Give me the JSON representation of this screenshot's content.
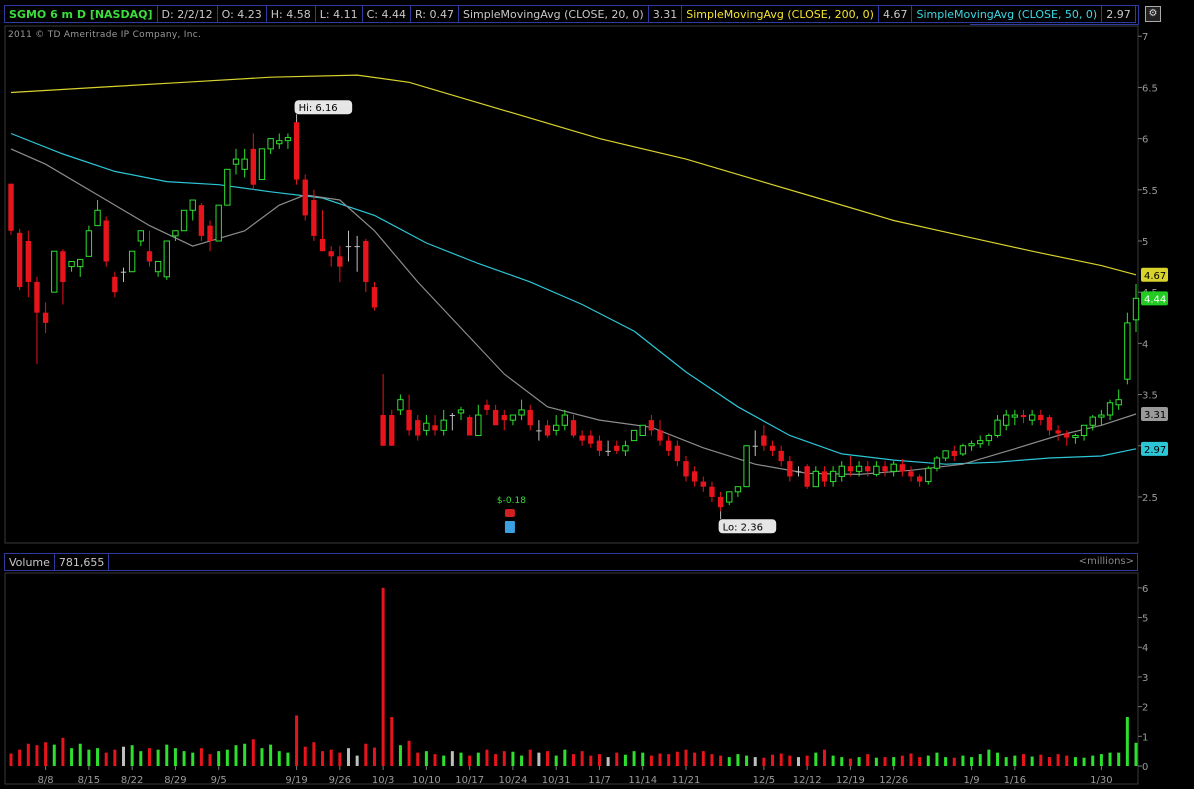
{
  "header": {
    "symbol": "SGMO 6 m D [NASDAQ]",
    "date": "D: 2/2/12",
    "open": "O: 4.23",
    "high": "H: 4.58",
    "low": "L: 4.11",
    "close": "C: 4.44",
    "range": "R: 0.47",
    "sma20_label": "SimpleMovingAvg (CLOSE, 20, 0)",
    "sma20_value": "3.31",
    "sma200_label": "SimpleMovingAvg (CLOSE, 200, 0)",
    "sma200_value": "4.67",
    "sma50_label": "SimpleMovingAvg (CLOSE, 50, 0)",
    "sma50_value": "2.97"
  },
  "copyright": "2011 © TD Ameritrade IP Company, Inc.",
  "volume_panel": {
    "label": "Volume",
    "value": "781,655",
    "units": "<millions>"
  },
  "annotations": {
    "hi": "Hi: 6.16",
    "lo": "Lo: 2.36",
    "event": "$-0.18"
  },
  "chart_data": [
    {
      "type": "candlestick",
      "title": "SGMO 6 m D [NASDAQ]",
      "ylim": [
        2.05,
        7.1
      ],
      "yticks": [
        2.5,
        3,
        3.5,
        4,
        4.5,
        5,
        5.5,
        6,
        6.5,
        7
      ],
      "x_tick_labels": [
        "8/8",
        "8/15",
        "8/22",
        "8/29",
        "9/5",
        "9/19",
        "9/26",
        "10/3",
        "10/10",
        "10/17",
        "10/24",
        "10/31",
        "11/7",
        "11/14",
        "11/21",
        "12/5",
        "12/12",
        "12/19",
        "12/26",
        "1/9",
        "1/16",
        "1/30"
      ],
      "x_tick_days": [
        4,
        9,
        14,
        19,
        24,
        33,
        38,
        43,
        48,
        53,
        58,
        63,
        68,
        73,
        78,
        87,
        92,
        97,
        102,
        111,
        116,
        126
      ],
      "candles": [
        [
          5.56,
          5.45,
          5.1,
          5.06
        ],
        [
          5.08,
          5.12,
          4.55,
          4.52
        ],
        [
          5.0,
          5.1,
          4.6,
          4.45
        ],
        [
          4.6,
          4.65,
          4.3,
          3.8
        ],
        [
          4.3,
          4.4,
          4.2,
          4.1
        ],
        [
          4.5,
          4.5,
          4.9,
          4.85
        ],
        [
          4.9,
          4.92,
          4.6,
          4.38
        ],
        [
          4.75,
          4.8,
          4.8,
          4.7
        ],
        [
          4.75,
          4.75,
          4.82,
          4.65
        ],
        [
          4.85,
          4.95,
          5.1,
          5.15
        ],
        [
          5.15,
          5.3,
          5.3,
          5.4
        ],
        [
          5.2,
          5.24,
          4.8,
          4.75
        ],
        [
          4.65,
          4.7,
          4.5,
          4.45
        ],
        [
          4.7,
          4.74,
          4.7,
          4.6
        ],
        [
          4.7,
          4.7,
          4.9,
          4.85
        ],
        [
          5.0,
          5.08,
          5.1,
          4.95
        ],
        [
          4.9,
          5.1,
          4.8,
          4.75
        ],
        [
          4.7,
          4.72,
          4.8,
          4.65
        ],
        [
          4.65,
          4.65,
          5.0,
          4.62
        ],
        [
          5.05,
          5.05,
          5.1,
          5.0
        ],
        [
          5.1,
          5.3,
          5.3,
          5.1
        ],
        [
          5.3,
          5.4,
          5.4,
          5.2
        ],
        [
          5.35,
          5.37,
          5.05,
          5.0
        ],
        [
          5.15,
          5.2,
          5.0,
          4.9
        ],
        [
          5.0,
          5.05,
          5.35,
          5.0
        ],
        [
          5.35,
          5.4,
          5.7,
          5.35
        ],
        [
          5.75,
          5.9,
          5.8,
          5.65
        ],
        [
          5.7,
          5.9,
          5.8,
          5.62
        ],
        [
          5.9,
          6.05,
          5.55,
          5.5
        ],
        [
          5.6,
          5.8,
          5.9,
          5.6
        ],
        [
          5.9,
          6.0,
          6.0,
          5.85
        ],
        [
          5.95,
          6.05,
          5.98,
          5.9
        ],
        [
          5.98,
          6.05,
          6.01,
          5.9
        ],
        [
          6.16,
          6.16,
          5.6,
          5.55
        ],
        [
          5.6,
          5.65,
          5.25,
          5.2
        ],
        [
          5.4,
          5.5,
          5.05,
          5.0
        ],
        [
          5.02,
          5.3,
          4.9,
          4.9
        ],
        [
          4.9,
          4.95,
          4.85,
          4.75
        ],
        [
          4.85,
          4.95,
          4.75,
          4.6
        ],
        [
          4.95,
          5.1,
          4.95,
          4.8
        ],
        [
          4.95,
          5.05,
          4.95,
          4.7
        ],
        [
          5.0,
          5.02,
          4.6,
          4.5
        ],
        [
          4.55,
          4.6,
          4.35,
          4.32
        ],
        [
          3.3,
          3.7,
          3.0,
          3.0
        ],
        [
          3.3,
          3.35,
          3.0,
          3.0
        ],
        [
          3.35,
          3.5,
          3.45,
          3.3
        ],
        [
          3.35,
          3.5,
          3.15,
          3.1
        ],
        [
          3.25,
          3.3,
          3.1,
          3.05
        ],
        [
          3.15,
          3.3,
          3.22,
          3.1
        ],
        [
          3.2,
          3.3,
          3.15,
          3.1
        ],
        [
          3.15,
          3.35,
          3.25,
          3.1
        ],
        [
          3.3,
          3.32,
          3.3,
          3.15
        ],
        [
          3.32,
          3.38,
          3.35,
          3.25
        ],
        [
          3.28,
          3.3,
          3.1,
          3.1
        ],
        [
          3.1,
          3.4,
          3.3,
          3.1
        ],
        [
          3.4,
          3.45,
          3.35,
          3.3
        ],
        [
          3.35,
          3.4,
          3.2,
          3.2
        ],
        [
          3.3,
          3.35,
          3.25,
          3.15
        ],
        [
          3.25,
          3.3,
          3.3,
          3.2
        ],
        [
          3.3,
          3.45,
          3.35,
          3.25
        ],
        [
          3.35,
          3.4,
          3.2,
          3.15
        ],
        [
          3.15,
          3.25,
          3.15,
          3.05
        ],
        [
          3.2,
          3.25,
          3.1,
          3.08
        ],
        [
          3.15,
          3.3,
          3.2,
          3.1
        ],
        [
          3.2,
          3.35,
          3.3,
          3.15
        ],
        [
          3.25,
          3.3,
          3.1,
          3.08
        ],
        [
          3.1,
          3.15,
          3.05,
          3.0
        ],
        [
          3.1,
          3.15,
          3.02,
          2.98
        ],
        [
          3.05,
          3.1,
          2.95,
          2.9
        ],
        [
          2.95,
          3.05,
          2.95,
          2.9
        ],
        [
          3.0,
          3.05,
          2.95,
          2.92
        ],
        [
          2.95,
          3.05,
          3.0,
          2.9
        ],
        [
          3.05,
          3.15,
          3.15,
          3.05
        ],
        [
          3.1,
          3.2,
          3.2,
          3.1
        ],
        [
          3.25,
          3.3,
          3.15,
          3.1
        ],
        [
          3.15,
          3.25,
          3.05,
          3.0
        ],
        [
          3.05,
          3.1,
          2.95,
          2.9
        ],
        [
          3.0,
          3.05,
          2.85,
          2.8
        ],
        [
          2.85,
          2.9,
          2.7,
          2.65
        ],
        [
          2.75,
          2.8,
          2.65,
          2.6
        ],
        [
          2.65,
          2.7,
          2.6,
          2.55
        ],
        [
          2.6,
          2.65,
          2.5,
          2.45
        ],
        [
          2.5,
          2.55,
          2.4,
          2.36
        ],
        [
          2.45,
          2.55,
          2.55,
          2.42
        ],
        [
          2.55,
          2.6,
          2.6,
          2.5
        ],
        [
          2.6,
          3.0,
          3.0,
          2.6
        ],
        [
          3.0,
          3.15,
          3.0,
          2.9
        ],
        [
          3.1,
          3.2,
          3.0,
          2.95
        ],
        [
          3.0,
          3.05,
          2.95,
          2.9
        ],
        [
          2.95,
          3.0,
          2.85,
          2.8
        ],
        [
          2.85,
          2.9,
          2.7,
          2.65
        ],
        [
          2.75,
          2.8,
          2.75,
          2.7
        ],
        [
          2.8,
          2.82,
          2.6,
          2.58
        ],
        [
          2.6,
          2.8,
          2.75,
          2.6
        ],
        [
          2.75,
          2.8,
          2.65,
          2.6
        ],
        [
          2.65,
          2.8,
          2.75,
          2.6
        ],
        [
          2.7,
          2.85,
          2.8,
          2.65
        ],
        [
          2.8,
          2.9,
          2.75,
          2.7
        ],
        [
          2.75,
          2.85,
          2.8,
          2.7
        ],
        [
          2.8,
          2.85,
          2.75,
          2.7
        ],
        [
          2.72,
          2.85,
          2.8,
          2.7
        ],
        [
          2.8,
          2.85,
          2.75,
          2.7
        ],
        [
          2.75,
          2.85,
          2.82,
          2.7
        ],
        [
          2.82,
          2.87,
          2.75,
          2.7
        ],
        [
          2.75,
          2.8,
          2.7,
          2.65
        ],
        [
          2.7,
          2.72,
          2.65,
          2.6
        ],
        [
          2.65,
          2.8,
          2.78,
          2.62
        ],
        [
          2.78,
          2.9,
          2.88,
          2.75
        ],
        [
          2.88,
          2.95,
          2.95,
          2.85
        ],
        [
          2.95,
          3.0,
          2.9,
          2.85
        ],
        [
          2.92,
          3.02,
          3.0,
          2.9
        ],
        [
          3.0,
          3.05,
          3.02,
          2.95
        ],
        [
          3.02,
          3.1,
          3.05,
          2.98
        ],
        [
          3.05,
          3.12,
          3.1,
          3.0
        ],
        [
          3.1,
          3.3,
          3.25,
          3.08
        ],
        [
          3.2,
          3.35,
          3.3,
          3.15
        ],
        [
          3.28,
          3.35,
          3.3,
          3.2
        ],
        [
          3.3,
          3.35,
          3.28,
          3.22
        ],
        [
          3.25,
          3.35,
          3.3,
          3.2
        ],
        [
          3.3,
          3.35,
          3.25,
          3.2
        ],
        [
          3.28,
          3.3,
          3.15,
          3.1
        ],
        [
          3.15,
          3.2,
          3.12,
          3.05
        ],
        [
          3.12,
          3.15,
          3.08,
          3.0
        ],
        [
          3.08,
          3.12,
          3.1,
          3.02
        ],
        [
          3.1,
          3.2,
          3.2,
          3.05
        ],
        [
          3.2,
          3.3,
          3.28,
          3.15
        ],
        [
          3.28,
          3.35,
          3.3,
          3.2
        ],
        [
          3.3,
          3.45,
          3.42,
          3.25
        ],
        [
          3.4,
          3.55,
          3.45,
          3.35
        ],
        [
          3.65,
          4.3,
          4.2,
          3.6
        ],
        [
          4.23,
          4.58,
          4.44,
          4.11
        ]
      ],
      "sma20": [
        [
          0,
          5.9
        ],
        [
          4,
          5.75
        ],
        [
          10,
          5.45
        ],
        [
          16,
          5.15
        ],
        [
          21,
          4.95
        ],
        [
          27,
          5.1
        ],
        [
          31,
          5.35
        ],
        [
          34,
          5.45
        ],
        [
          38,
          5.4
        ],
        [
          42,
          5.1
        ],
        [
          47,
          4.6
        ],
        [
          52,
          4.15
        ],
        [
          57,
          3.7
        ],
        [
          62,
          3.38
        ],
        [
          68,
          3.25
        ],
        [
          74,
          3.18
        ],
        [
          80,
          2.98
        ],
        [
          86,
          2.82
        ],
        [
          92,
          2.73
        ],
        [
          98,
          2.72
        ],
        [
          104,
          2.76
        ],
        [
          110,
          2.82
        ],
        [
          116,
          2.97
        ],
        [
          121,
          3.1
        ],
        [
          126,
          3.2
        ],
        [
          130,
          3.31
        ]
      ],
      "sma50": [
        [
          0,
          6.05
        ],
        [
          6,
          5.85
        ],
        [
          12,
          5.68
        ],
        [
          18,
          5.58
        ],
        [
          24,
          5.55
        ],
        [
          30,
          5.48
        ],
        [
          36,
          5.42
        ],
        [
          42,
          5.25
        ],
        [
          48,
          4.98
        ],
        [
          54,
          4.78
        ],
        [
          60,
          4.6
        ],
        [
          66,
          4.38
        ],
        [
          72,
          4.12
        ],
        [
          78,
          3.72
        ],
        [
          84,
          3.38
        ],
        [
          90,
          3.1
        ],
        [
          96,
          2.92
        ],
        [
          102,
          2.86
        ],
        [
          108,
          2.82
        ],
        [
          114,
          2.84
        ],
        [
          120,
          2.88
        ],
        [
          126,
          2.9
        ],
        [
          130,
          2.97
        ]
      ],
      "sma200": [
        [
          0,
          6.45
        ],
        [
          10,
          6.5
        ],
        [
          20,
          6.55
        ],
        [
          30,
          6.6
        ],
        [
          40,
          6.62
        ],
        [
          46,
          6.55
        ],
        [
          52,
          6.4
        ],
        [
          60,
          6.2
        ],
        [
          68,
          6.0
        ],
        [
          78,
          5.8
        ],
        [
          86,
          5.6
        ],
        [
          94,
          5.4
        ],
        [
          102,
          5.2
        ],
        [
          110,
          5.05
        ],
        [
          118,
          4.9
        ],
        [
          126,
          4.76
        ],
        [
          130,
          4.67
        ]
      ],
      "last_values": {
        "sma200": 4.67,
        "close": 4.44,
        "sma20": 3.31,
        "sma50": 2.97
      }
    },
    {
      "type": "bar",
      "title": "Volume",
      "ylabel": "<millions>",
      "ylim": [
        0,
        6.5
      ],
      "yticks": [
        0,
        1,
        2,
        3,
        4,
        5,
        6
      ],
      "values": [
        0.42,
        0.55,
        0.75,
        0.7,
        0.8,
        0.72,
        0.95,
        0.6,
        0.75,
        0.55,
        0.6,
        0.45,
        0.55,
        0.65,
        0.7,
        0.5,
        0.6,
        0.55,
        0.72,
        0.6,
        0.5,
        0.45,
        0.6,
        0.4,
        0.5,
        0.55,
        0.7,
        0.75,
        0.9,
        0.6,
        0.72,
        0.5,
        0.45,
        1.7,
        0.65,
        0.8,
        0.5,
        0.55,
        0.45,
        0.6,
        0.35,
        0.75,
        0.62,
        6.0,
        1.65,
        0.7,
        0.85,
        0.45,
        0.5,
        0.4,
        0.35,
        0.5,
        0.45,
        0.35,
        0.45,
        0.55,
        0.4,
        0.5,
        0.48,
        0.35,
        0.55,
        0.45,
        0.5,
        0.35,
        0.55,
        0.4,
        0.5,
        0.35,
        0.4,
        0.3,
        0.45,
        0.38,
        0.5,
        0.45,
        0.35,
        0.42,
        0.4,
        0.48,
        0.55,
        0.45,
        0.5,
        0.4,
        0.35,
        0.3,
        0.4,
        0.35,
        0.3,
        0.28,
        0.38,
        0.42,
        0.35,
        0.3,
        0.35,
        0.45,
        0.55,
        0.35,
        0.3,
        0.25,
        0.3,
        0.4,
        0.28,
        0.3,
        0.3,
        0.35,
        0.42,
        0.3,
        0.35,
        0.45,
        0.3,
        0.28,
        0.35,
        0.3,
        0.4,
        0.55,
        0.45,
        0.3,
        0.35,
        0.4,
        0.32,
        0.38,
        0.3,
        0.4,
        0.35,
        0.3,
        0.28,
        0.35,
        0.4,
        0.45,
        0.45,
        1.65,
        0.78
      ],
      "colors": "candle direction"
    }
  ],
  "colors": {
    "up": "#2ee02e",
    "down": "#e8141c",
    "sma20": "#8c8c8c",
    "sma50": "#2dc6d6",
    "sma200": "#d8d22c",
    "flat": "#c0c0c0",
    "axis_text": "#9a9a9a",
    "header_border": "#2d3aa0"
  }
}
